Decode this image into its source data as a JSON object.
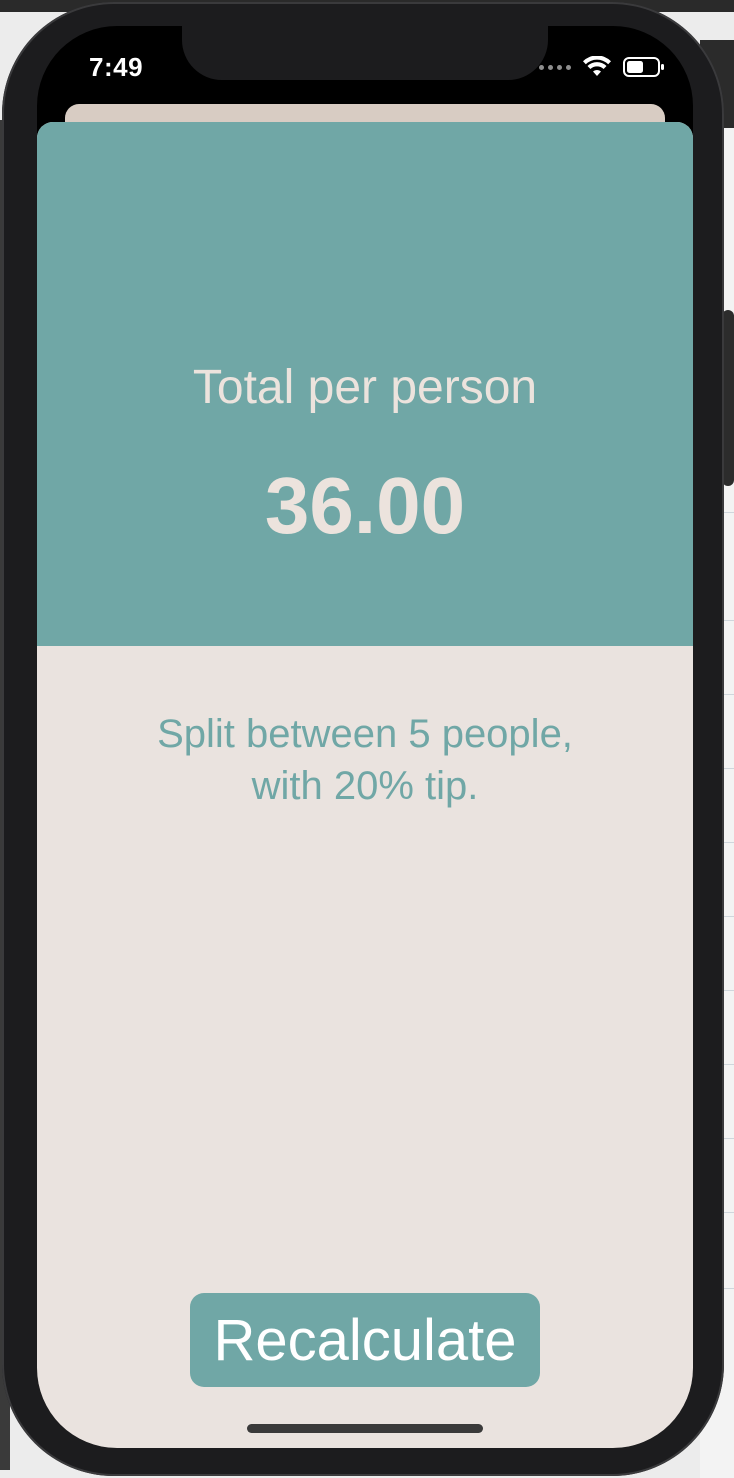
{
  "status_bar": {
    "time": "7:49",
    "icons": [
      "signal-dots-icon",
      "wifi-icon",
      "battery-icon"
    ]
  },
  "result": {
    "title": "Total per person",
    "amount": "36.00",
    "summary_line1": "Split between 5 people,",
    "summary_line2": "with 20% tip."
  },
  "actions": {
    "recalculate_label": "Recalculate"
  },
  "colors": {
    "accent": "#70a7a6",
    "sheet_background": "#eae3df",
    "result_text": "#ece3dd",
    "button_text": "#ffffff"
  }
}
